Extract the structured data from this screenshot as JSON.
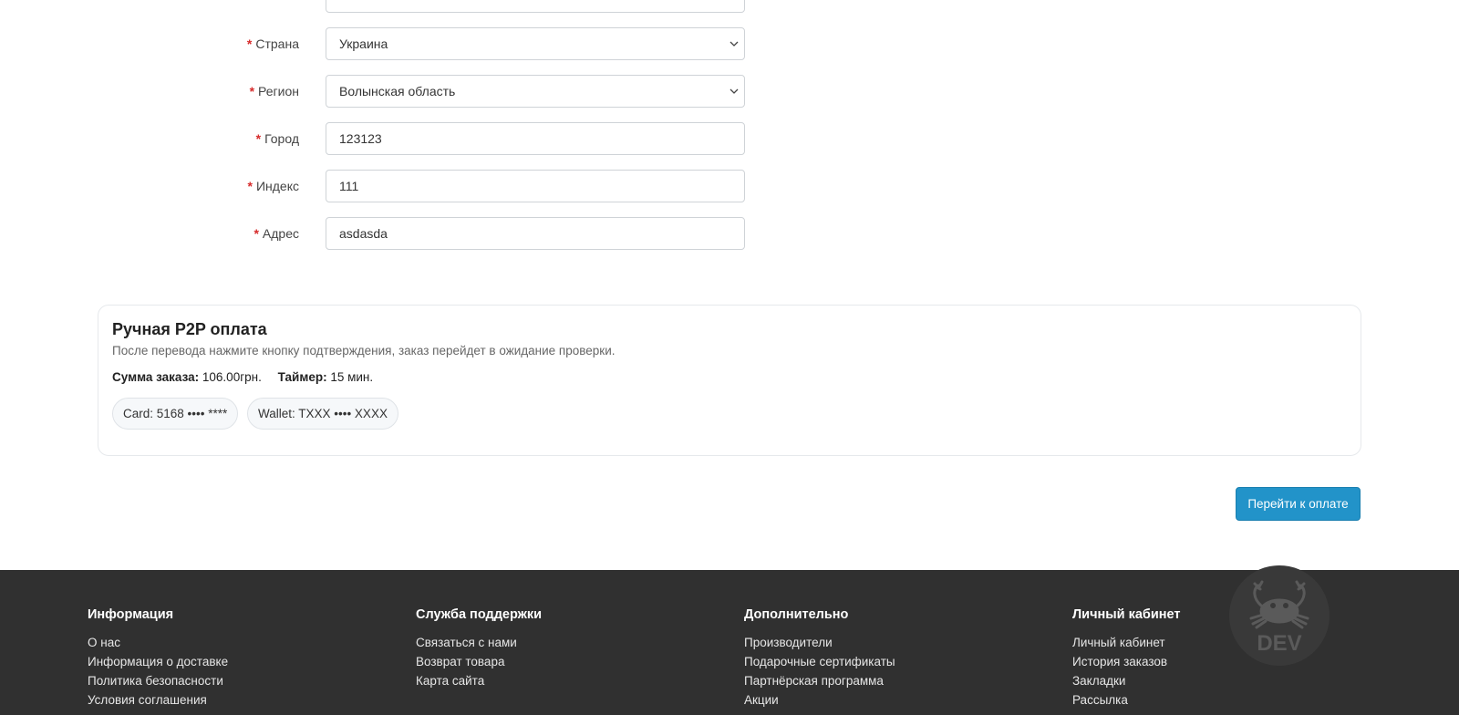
{
  "form": {
    "country": {
      "label": "Страна",
      "value": "Украина"
    },
    "region": {
      "label": "Регион",
      "value": "Волынская область"
    },
    "city": {
      "label": "Город",
      "value": "123123"
    },
    "postcode": {
      "label": "Индекс",
      "value": "111"
    },
    "address": {
      "label": "Адрес",
      "value": "asdasda"
    },
    "required_mark": "*"
  },
  "p2p": {
    "title": "Ручная P2P оплата",
    "description": "После перевода нажмите кнопку подтверждения, заказ перейдет в ожидание проверки.",
    "sum_label": "Сумма заказа:",
    "sum_value": "106.00грн.",
    "timer_label": "Таймер:",
    "timer_value": "15 мин.",
    "card": "Card: 5168 •••• ****",
    "wallet": "Wallet: TXXX •••• XXXX"
  },
  "actions": {
    "pay_label": "Перейти к оплате"
  },
  "footer": {
    "columns": [
      {
        "title": "Информация",
        "links": [
          "О нас",
          "Информация о доставке",
          "Политика безопасности",
          "Условия соглашения"
        ]
      },
      {
        "title": "Служба поддержки",
        "links": [
          "Связаться с нами",
          "Возврат товара",
          "Карта сайта"
        ]
      },
      {
        "title": "Дополнительно",
        "links": [
          "Производители",
          "Подарочные сертификаты",
          "Партнёрская программа",
          "Акции"
        ]
      },
      {
        "title": "Личный кабинет",
        "links": [
          "Личный кабинет",
          "История заказов",
          "Закладки",
          "Рассылка"
        ]
      }
    ],
    "badge_text": "DEV",
    "badge_icon": "crab-icon"
  },
  "colors": {
    "accent": "#2293c9",
    "required": "#d62b2b",
    "footer_bg": "#303030"
  }
}
